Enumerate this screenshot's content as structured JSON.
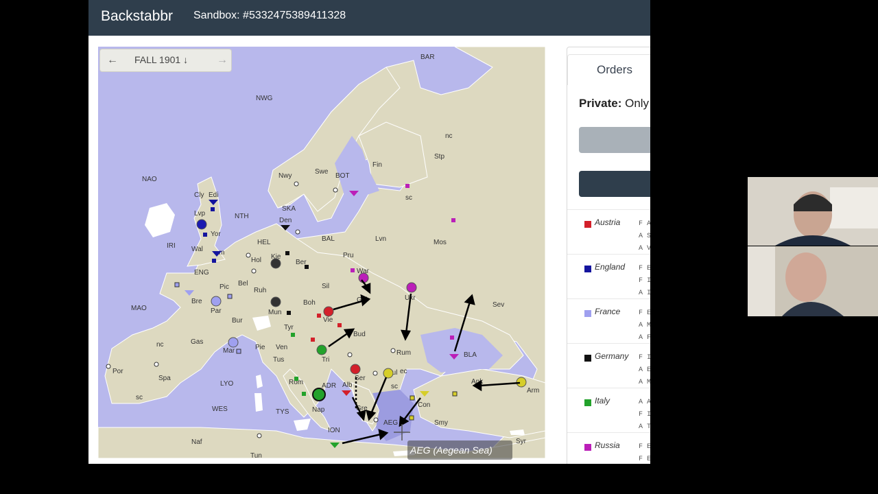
{
  "navbar": {
    "brand": "Backstabbr",
    "sandbox": "Sandbox: #5332475389411328"
  },
  "phase": {
    "label": "FALL 1901 ↓",
    "prev_icon": "arrow-left-icon",
    "next_icon": "arrow-right-icon"
  },
  "map": {
    "labels": {
      "BAR": "BAR",
      "NWG": "NWG",
      "NAO": "NAO",
      "Fin": "Fin",
      "Stp": "Stp",
      "nc_stp": "nc",
      "sc_stp": "sc",
      "Nwy": "Nwy",
      "Swe": "Swe",
      "BOT": "BOT",
      "NTH": "NTH",
      "Cly": "Cly",
      "Edi": "Edi",
      "Lvp": "Lvp",
      "Yor": "Yor",
      "Wal": "Wal",
      "Lon": "m",
      "IRI": "IRI",
      "SKA": "SKA",
      "Den": "Den",
      "HEL": "HEL",
      "BAL": "BAL",
      "Lvn": "Lvn",
      "Mos": "Mos",
      "Kie": "Kie",
      "Ber": "Ber",
      "Pru": "Pru",
      "Hol": "Hol",
      "ENG": "ENG",
      "Bel": "Bel",
      "Pic": "Pic",
      "Ruh": "Ruh",
      "Sil": "Sil",
      "War": "War",
      "Bre": "Bre",
      "Par": "Par",
      "Mun": "Mun",
      "Boh": "Boh",
      "Gal": "Gal",
      "Ukr": "Ukr",
      "MAO": "MAO",
      "Vie": "Vie",
      "Bur": "Bur",
      "Tyr": "Tyr",
      "Bud": "Bud",
      "Sev": "Sev",
      "nc_spa": "nc",
      "Gas": "Gas",
      "Mar": "Mar",
      "Pie": "Pie",
      "Ven": "Ven",
      "Tri": "Tri",
      "Rum": "Rum",
      "BLA": "BLA",
      "Por": "Por",
      "Spa": "Spa",
      "sc_spa": "sc",
      "Tus": "Tus",
      "LYO": "LYO",
      "Rom": "Rom",
      "ADR": "ADR",
      "Ser": "Ser",
      "Bul": "Bul",
      "ec_bul": "ec",
      "sc_bul": "sc",
      "Alb": "Alb",
      "Ank": "Ank",
      "Arm": "Arm",
      "Con": "Con",
      "Nap": "Nap",
      "WES": "WES",
      "TYS": "TYS",
      "Gre": "Gre",
      "AEG": "AEG",
      "Smy": "Smy",
      "ION": "ION",
      "Naf": "Naf",
      "Syr": "Syr",
      "Tun": "Tun"
    }
  },
  "tooltip": {
    "text": "AEG (Aegean Sea)"
  },
  "panel": {
    "tab": "Orders",
    "private_label": "Private:",
    "private_text": " Only y",
    "nations": [
      {
        "name": "Austria",
        "color": "#d3202a",
        "orders": "F A\nA S\nA V"
      },
      {
        "name": "England",
        "color": "#14149e",
        "orders": "F E\nF I\nA I"
      },
      {
        "name": "France",
        "color": "#9fa0ef",
        "orders": "F E\nA M\nA F"
      },
      {
        "name": "Germany",
        "color": "#111111",
        "orders": "F I\nA E\nA M"
      },
      {
        "name": "Italy",
        "color": "#23a22b",
        "orders": "A A\nF I\nA T"
      },
      {
        "name": "Russia",
        "color": "#bb1fb8",
        "orders": "F E\nF E"
      }
    ]
  },
  "colors": {
    "navbar": "#2f3e4c",
    "water": "#b8b8ec",
    "land": "#ddd9c0"
  }
}
